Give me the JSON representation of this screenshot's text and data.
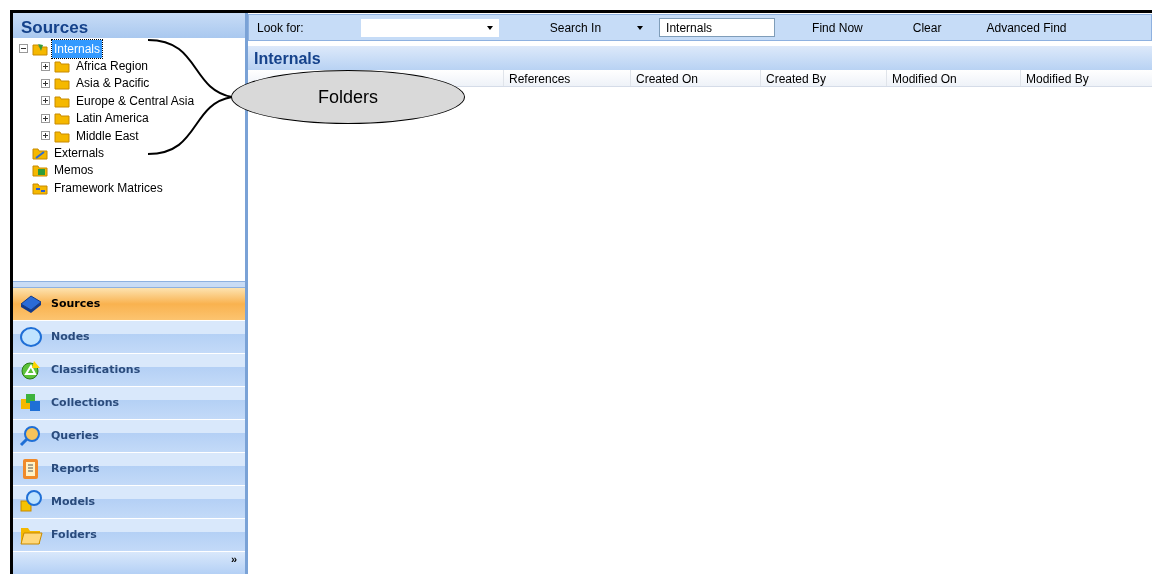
{
  "sidebar": {
    "title": "Sources",
    "tree": [
      {
        "label": "Internals",
        "kind": "folder-open",
        "expanded": true,
        "selected": true,
        "children": [
          {
            "label": "Africa Region",
            "kind": "folder",
            "expanded": false,
            "selected": false
          },
          {
            "label": "Asia & Pacific",
            "kind": "folder",
            "expanded": false,
            "selected": false
          },
          {
            "label": "Europe & Central Asia",
            "kind": "folder",
            "expanded": false,
            "selected": false
          },
          {
            "label": "Latin America",
            "kind": "folder",
            "expanded": false,
            "selected": false
          },
          {
            "label": "Middle East",
            "kind": "folder",
            "expanded": false,
            "selected": false
          }
        ]
      },
      {
        "label": "Externals",
        "kind": "externals",
        "selected": false
      },
      {
        "label": "Memos",
        "kind": "memos",
        "selected": false
      },
      {
        "label": "Framework Matrices",
        "kind": "matrices",
        "selected": false
      }
    ],
    "nav": [
      {
        "label": "Sources",
        "kind": "sources",
        "selected": true
      },
      {
        "label": "Nodes",
        "kind": "nodes",
        "selected": false
      },
      {
        "label": "Classifications",
        "kind": "classifications",
        "selected": false
      },
      {
        "label": "Collections",
        "kind": "collections",
        "selected": false
      },
      {
        "label": "Queries",
        "kind": "queries",
        "selected": false
      },
      {
        "label": "Reports",
        "kind": "reports",
        "selected": false
      },
      {
        "label": "Models",
        "kind": "models",
        "selected": false
      },
      {
        "label": "Folders",
        "kind": "folders",
        "selected": false
      }
    ],
    "more": "»"
  },
  "toolbar": {
    "look_for_label": "Look for:",
    "search_in": "Search In",
    "search_in_value": "Internals",
    "find_now": "Find Now",
    "clear": "Clear",
    "advanced_find": "Advanced Find"
  },
  "list": {
    "title": "Internals",
    "columns": [
      "References",
      "Created On",
      "Created By",
      "Modified On",
      "Modified By"
    ]
  },
  "callout": {
    "label": "Folders"
  }
}
